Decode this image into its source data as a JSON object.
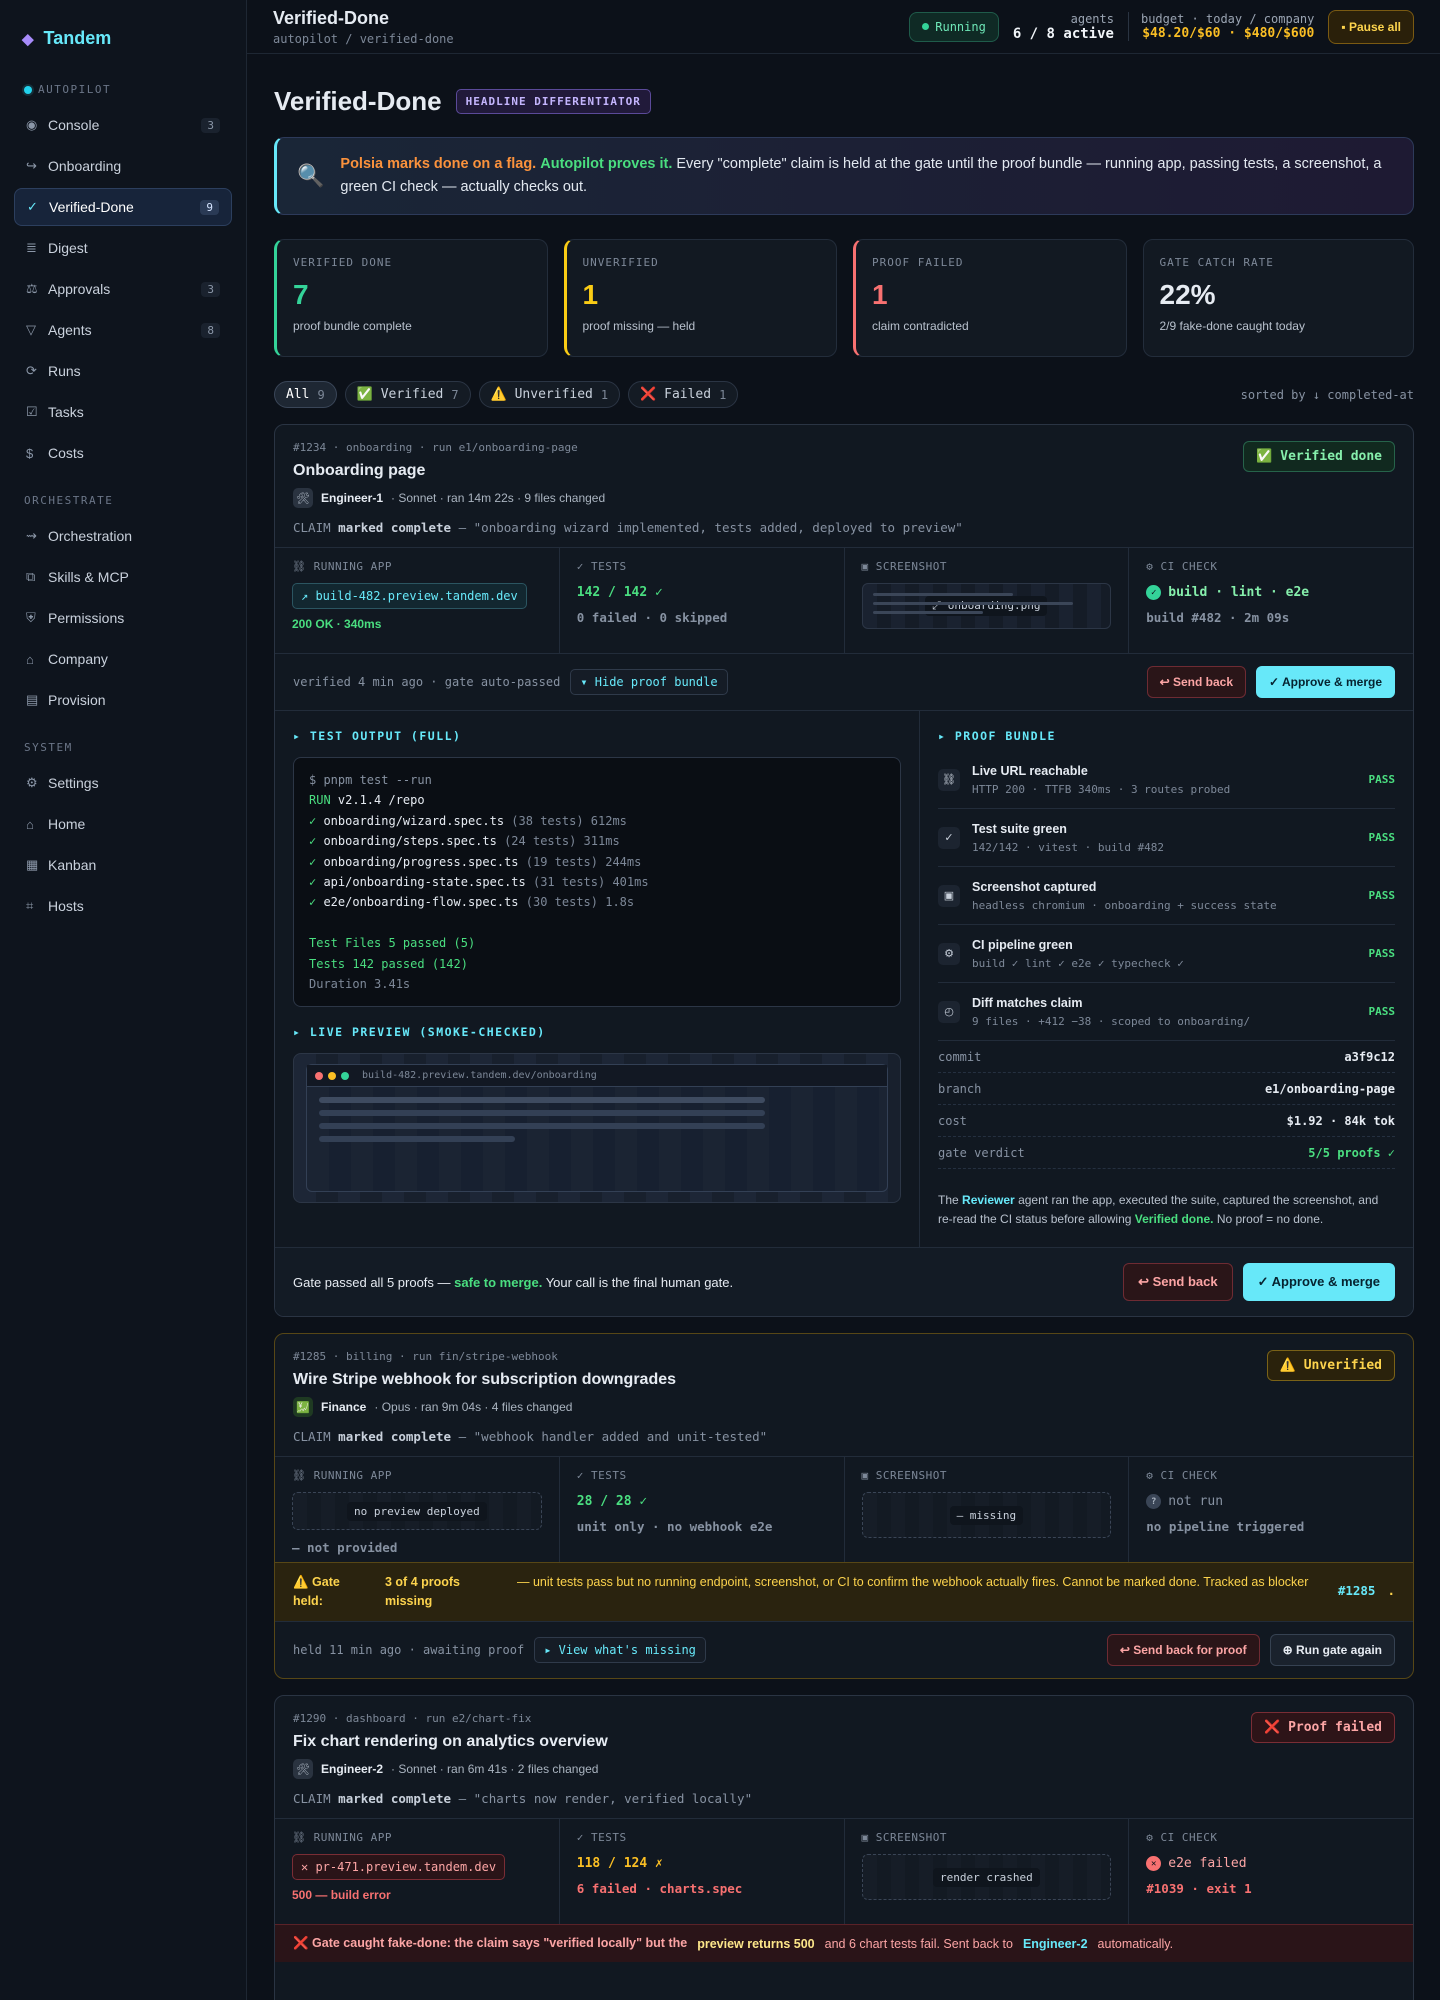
{
  "brand": {
    "name": "Tandem",
    "logo_icon": "diamond-icon"
  },
  "sidebar": {
    "sections": [
      {
        "title": "AUTOPILOT",
        "items": [
          {
            "label": "Console",
            "icon": "◉",
            "count": "3"
          },
          {
            "label": "Onboarding",
            "icon": "↪",
            "count": ""
          },
          {
            "label": "Verified-Done",
            "icon": "✓",
            "count": "9",
            "active": true
          },
          {
            "label": "Digest",
            "icon": "≣",
            "count": ""
          },
          {
            "label": "Approvals",
            "icon": "⚖",
            "count": "3"
          },
          {
            "label": "Agents",
            "icon": "▽",
            "count": "8"
          },
          {
            "label": "Runs",
            "icon": "⟳",
            "count": ""
          },
          {
            "label": "Tasks",
            "icon": "☑",
            "count": ""
          },
          {
            "label": "Costs",
            "icon": "$",
            "count": ""
          }
        ]
      },
      {
        "title": "ORCHESTRATE",
        "items": [
          {
            "label": "Orchestration",
            "icon": "⇝",
            "count": ""
          },
          {
            "label": "Skills & MCP",
            "icon": "⧉",
            "count": ""
          },
          {
            "label": "Permissions",
            "icon": "⛨",
            "count": ""
          },
          {
            "label": "Company",
            "icon": "⌂",
            "count": ""
          },
          {
            "label": "Provision",
            "icon": "▤",
            "count": ""
          }
        ]
      },
      {
        "title": "SYSTEM",
        "items": [
          {
            "label": "Settings",
            "icon": "⚙",
            "count": ""
          },
          {
            "label": "Home",
            "icon": "⌂",
            "count": ""
          },
          {
            "label": "Kanban",
            "icon": "▦",
            "count": ""
          },
          {
            "label": "Hosts",
            "icon": "⌗",
            "count": ""
          }
        ]
      }
    ]
  },
  "topbar": {
    "title": "Verified-Done",
    "crumb": "autopilot / verified-done",
    "running": "Running",
    "agents_label": "agents",
    "agents_value": "6 / 8 active",
    "budget_label": "budget · today / company",
    "budget_value": "$48.20/$60 · $480/$600",
    "pause": "▪ Pause all"
  },
  "page": {
    "title": "Verified-Done",
    "badge": "HEADLINE DIFFERENTIATOR",
    "banner": {
      "p1": "Polsia marks done on a flag.",
      "p2": "Autopilot proves it.",
      "p3": "Every \"complete\" claim is held at the gate until the proof bundle — running app, passing tests, a screenshot, a green CI check — actually checks out."
    }
  },
  "stats": [
    {
      "label": "VERIFIED DONE",
      "value": "7",
      "sub": "proof bundle complete",
      "tone": "g"
    },
    {
      "label": "UNVERIFIED",
      "value": "1",
      "sub": "proof missing — held",
      "tone": "y"
    },
    {
      "label": "PROOF FAILED",
      "value": "1",
      "sub": "claim contradicted",
      "tone": "r"
    },
    {
      "label": "GATE CATCH RATE",
      "value": "22%",
      "sub": "2/9 fake-done caught today",
      "tone": ""
    }
  ],
  "filters": [
    {
      "label": "All",
      "count": "9",
      "on": true
    },
    {
      "label": "✅ Verified",
      "count": "7"
    },
    {
      "label": "⚠️ Unverified",
      "count": "1"
    },
    {
      "label": "❌ Failed",
      "count": "1"
    }
  ],
  "sorted": "sorted by ↓ completed-at",
  "cards": [
    {
      "meta": "#1234 · onboarding · run e1/onboarding-page",
      "title": "Onboarding page",
      "agent_icon": "🛠",
      "agent": "Engineer-1",
      "agent_meta": "· Sonnet · ran 14m 22s · 9 files changed",
      "claim_pre": "CLAIM",
      "claim_mid": "marked complete",
      "claim_text": "— \"onboarding wizard implemented, tests added, deployed to preview\"",
      "status": "✅ Verified done",
      "app_label": "⛓ RUNNING APP",
      "app_url": "↗ build-482.preview.tandem.dev",
      "app_result": "200 OK · 340ms",
      "tests_label": "✓ TESTS",
      "tests_value": "142 / 142 ✓",
      "tests_sub": "0 failed · 0 skipped",
      "shot_label": "▣ SCREENSHOT",
      "shot_text": "⤢ onboarding.png",
      "ci_label": "⚙ CI CHECK",
      "ci_value": "build · lint · e2e",
      "ci_sub": "build #482 · 2m 09s",
      "actions_text": "verified 4 min ago · gate auto-passed",
      "toggle": "▾ Hide proof bundle",
      "send_back": "↩ Send back",
      "approve": "✓ Approve & merge",
      "test_output_title": "▸ TEST OUTPUT (FULL)",
      "terminal": [
        {
          "cls": "pr",
          "text": "$ pnpm test --run"
        },
        {
          "cls": "",
          "runword": "RUN",
          "text": " v2.1.4 /repo"
        },
        {
          "check": "✓",
          "file": " onboarding/wizard.spec.ts",
          "dim": " (38 tests) 612ms"
        },
        {
          "check": "✓",
          "file": " onboarding/steps.spec.ts",
          "dim": " (24 tests) 311ms"
        },
        {
          "check": "✓",
          "file": " onboarding/progress.spec.ts",
          "dim": " (19 tests) 244ms"
        },
        {
          "check": "✓",
          "file": " api/onboarding-state.spec.ts",
          "dim": " (31 tests) 401ms"
        },
        {
          "check": "✓",
          "file": " e2e/onboarding-flow.spec.ts",
          "dim": " (30 tests) 1.8s"
        },
        {
          "cls": "gr",
          "text": " "
        },
        {
          "cls": "gr",
          "text": "Test Files 5 passed (5)"
        },
        {
          "cls": "gr",
          "text": "Tests 142 passed (142)"
        },
        {
          "cls": "mut",
          "text": "Duration 3.41s"
        }
      ],
      "live_title": "▸ LIVE PREVIEW (SMOKE-CHECKED)",
      "live_url": "build-482.preview.tandem.dev/onboarding",
      "bundle_title": "▸ PROOF BUNDLE",
      "bundle": [
        {
          "icon": "⛓",
          "title": "Live URL reachable",
          "sub": "HTTP 200 · TTFB 340ms · 3 routes probed",
          "result": "PASS"
        },
        {
          "icon": "✓",
          "title": "Test suite green",
          "sub": "142/142 · vitest · build #482",
          "result": "PASS"
        },
        {
          "icon": "▣",
          "title": "Screenshot captured",
          "sub": "headless chromium · onboarding + success state",
          "result": "PASS"
        },
        {
          "icon": "⚙",
          "title": "CI pipeline green",
          "sub": "build ✓ lint ✓ e2e ✓ typecheck ✓",
          "result": "PASS"
        },
        {
          "icon": "◴",
          "title": "Diff matches claim",
          "sub": "9 files · +412 −38 · scoped to onboarding/",
          "result": "PASS"
        }
      ],
      "kv": [
        {
          "k": "commit",
          "v": "a3f9c12"
        },
        {
          "k": "branch",
          "v": "e1/onboarding-page"
        },
        {
          "k": "cost",
          "v": "$1.92 · 84k tok"
        },
        {
          "k": "gate verdict",
          "v": "5/5 proofs ✓",
          "green": true
        }
      ],
      "note": {
        "a": "The",
        "b": "Reviewer",
        "c": "agent ran the app, executed the suite, captured the screenshot, and re-read the CI status before allowing",
        "d": "Verified done.",
        "e": "No proof = no done."
      },
      "gate": {
        "a": "Gate passed all 5 proofs —",
        "b": "safe to merge.",
        "c": "Your call is the final human gate."
      }
    },
    {
      "meta": "#1285 · billing · run fin/stripe-webhook",
      "title": "Wire Stripe webhook for subscription downgrades",
      "agent_icon": "💹",
      "agent": "Finance",
      "agent_meta": "· Opus · ran 9m 04s · 4 files changed",
      "claim_pre": "CLAIM",
      "claim_mid": "marked complete",
      "claim_text": "— \"webhook handler added and unit-tested\"",
      "status": "⚠️ Unverified",
      "app_label": "⛓ RUNNING APP",
      "app_box": "no preview deployed",
      "app_result": "— not provided",
      "tests_label": "✓ TESTS",
      "tests_value": "28 / 28 ✓",
      "tests_sub": "unit only · no webhook e2e",
      "shot_label": "▣ SCREENSHOT",
      "shot_text": "— missing",
      "ci_label": "⚙ CI CHECK",
      "ci_value": "not run",
      "ci_sub": "no pipeline triggered",
      "held": {
        "a": "⚠️ Gate held:",
        "b": "3 of 4 proofs missing",
        "c": "— unit tests pass but no running endpoint, screenshot, or CI to confirm the webhook actually fires. Cannot be marked done. Tracked as blocker",
        "d": "#1285",
        "e": "."
      },
      "actions_text": "held 11 min ago · awaiting proof",
      "toggle": "▸ View what's missing",
      "send_back": "↩ Send back for proof",
      "rerun": "⊕ Run gate again"
    },
    {
      "meta": "#1290 · dashboard · run e2/chart-fix",
      "title": "Fix chart rendering on analytics overview",
      "agent_icon": "🛠",
      "agent": "Engineer-2",
      "agent_meta": "· Sonnet · ran 6m 41s · 2 files changed",
      "claim_pre": "CLAIM",
      "claim_mid": "marked complete",
      "claim_text": "— \"charts now render, verified locally\"",
      "status": "❌ Proof failed",
      "app_label": "⛓ RUNNING APP",
      "app_url": "✕ pr-471.preview.tandem.dev",
      "app_result": "500 — build error",
      "tests_label": "✓ TESTS",
      "tests_value": "118 / 124 ✗",
      "tests_sub": "6 failed · charts.spec",
      "shot_label": "▣ SCREENSHOT",
      "shot_text": "render crashed",
      "ci_label": "⚙ CI CHECK",
      "ci_value": "e2e failed",
      "ci_sub": "#1039 · exit 1",
      "fail": {
        "a": "❌ Gate caught fake-done: the claim says \"verified locally\" but the",
        "b": "preview returns 500",
        "c": "and 6 chart tests fail. Sent back to",
        "d": "Engineer-2",
        "e": "automatically."
      }
    }
  ]
}
